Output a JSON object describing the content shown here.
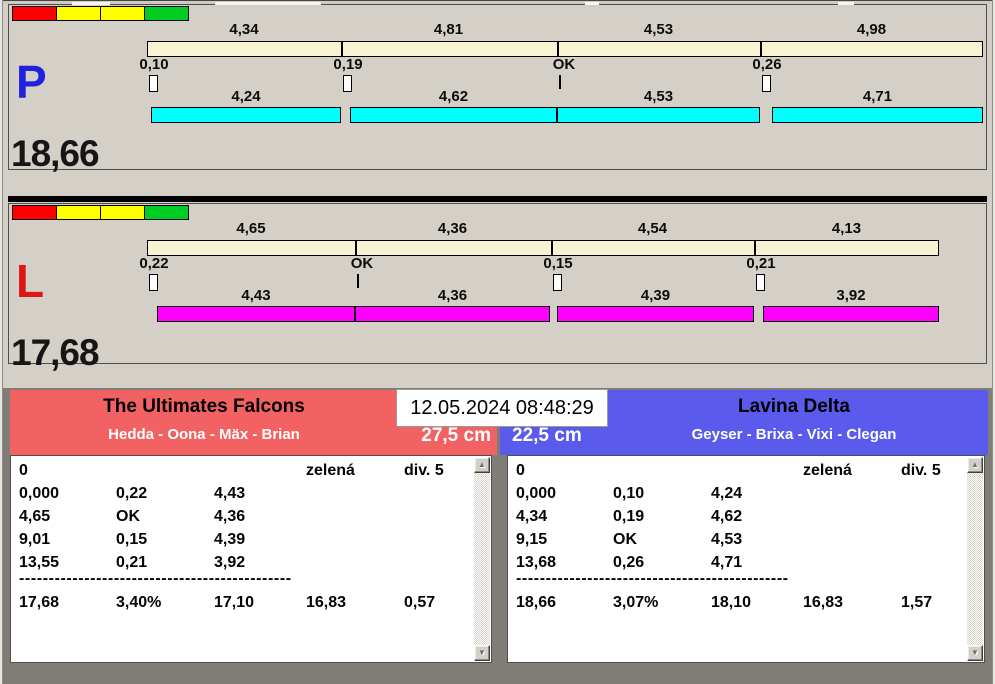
{
  "lanes": [
    {
      "letter": "P",
      "letter_color": "#2020dd",
      "total_label": "18,66",
      "total_seconds": 18.66,
      "bar_color": "#00ffff",
      "lights": [
        "#ff0000",
        "#ffff00",
        "#ffff00",
        "#00cc22"
      ],
      "splits": {
        "values": [
          4.34,
          4.81,
          4.53,
          4.98
        ],
        "labels": [
          "4,34",
          "4,81",
          "4,53",
          "4,98"
        ]
      },
      "dogs": {
        "values": [
          4.24,
          4.62,
          4.53,
          4.71
        ],
        "labels": [
          "4,24",
          "4,62",
          "4,53",
          "4,71"
        ]
      },
      "starts": {
        "values": [
          0.1,
          0.19,
          null,
          0.26
        ],
        "labels": [
          "0,10",
          "0,19",
          "OK",
          "0,26"
        ]
      }
    },
    {
      "letter": "L",
      "letter_color": "#e01616",
      "total_label": "17,68",
      "total_seconds": 17.68,
      "bar_color": "#ff00ff",
      "lights": [
        "#ff0000",
        "#ffff00",
        "#ffff00",
        "#00cc22"
      ],
      "splits": {
        "values": [
          4.65,
          4.36,
          4.54,
          4.13
        ],
        "labels": [
          "4,65",
          "4,36",
          "4,54",
          "4,13"
        ]
      },
      "dogs": {
        "values": [
          4.43,
          4.36,
          4.39,
          3.92
        ],
        "labels": [
          "4,43",
          "4,36",
          "4,39",
          "3,92"
        ]
      },
      "starts": {
        "values": [
          0.22,
          null,
          0.15,
          0.21
        ],
        "labels": [
          "0,22",
          "OK",
          "0,15",
          "0,21"
        ]
      }
    }
  ],
  "footer": {
    "datetime": "12.05.2024 08:48:29",
    "teams": [
      {
        "name": "The Ultimates Falcons",
        "members": "Hedda - Oona - Mäx - Brian",
        "jump_height": "27,5 cm",
        "header_color": "#f36262",
        "table": {
          "rows": [
            [
              "0",
              "",
              "",
              "zelená",
              "div. 5"
            ],
            [
              "0,000",
              "0,22",
              "4,43",
              "",
              ""
            ],
            [
              "4,65",
              "OK",
              "4,36",
              "",
              ""
            ],
            [
              "9,01",
              "0,15",
              "4,39",
              "",
              ""
            ],
            [
              "13,55",
              "0,21",
              "3,92",
              "",
              ""
            ]
          ],
          "separator": "----------------------------------------------",
          "summary": [
            "17,68",
            "3,40%",
            "17,10",
            "16,83",
            "0,57"
          ]
        }
      },
      {
        "name": "Lavina Delta",
        "members": "Geyser - Brixa - Vixi - Clegan",
        "jump_height": "22,5 cm",
        "header_color": "#5a5aec",
        "table": {
          "rows": [
            [
              "0",
              "",
              "",
              "zelená",
              "div. 5"
            ],
            [
              "0,000",
              "0,10",
              "4,24",
              "",
              ""
            ],
            [
              "4,34",
              "0,19",
              "4,62",
              "",
              ""
            ],
            [
              "9,15",
              "OK",
              "4,53",
              "",
              ""
            ],
            [
              "13,68",
              "0,26",
              "4,71",
              "",
              ""
            ]
          ],
          "separator": "----------------------------------------------",
          "summary": [
            "18,66",
            "3,07%",
            "18,10",
            "16,83",
            "1,57"
          ]
        }
      }
    ]
  },
  "scrollbar": {
    "up_glyph": "▲",
    "down_glyph": "▼"
  }
}
